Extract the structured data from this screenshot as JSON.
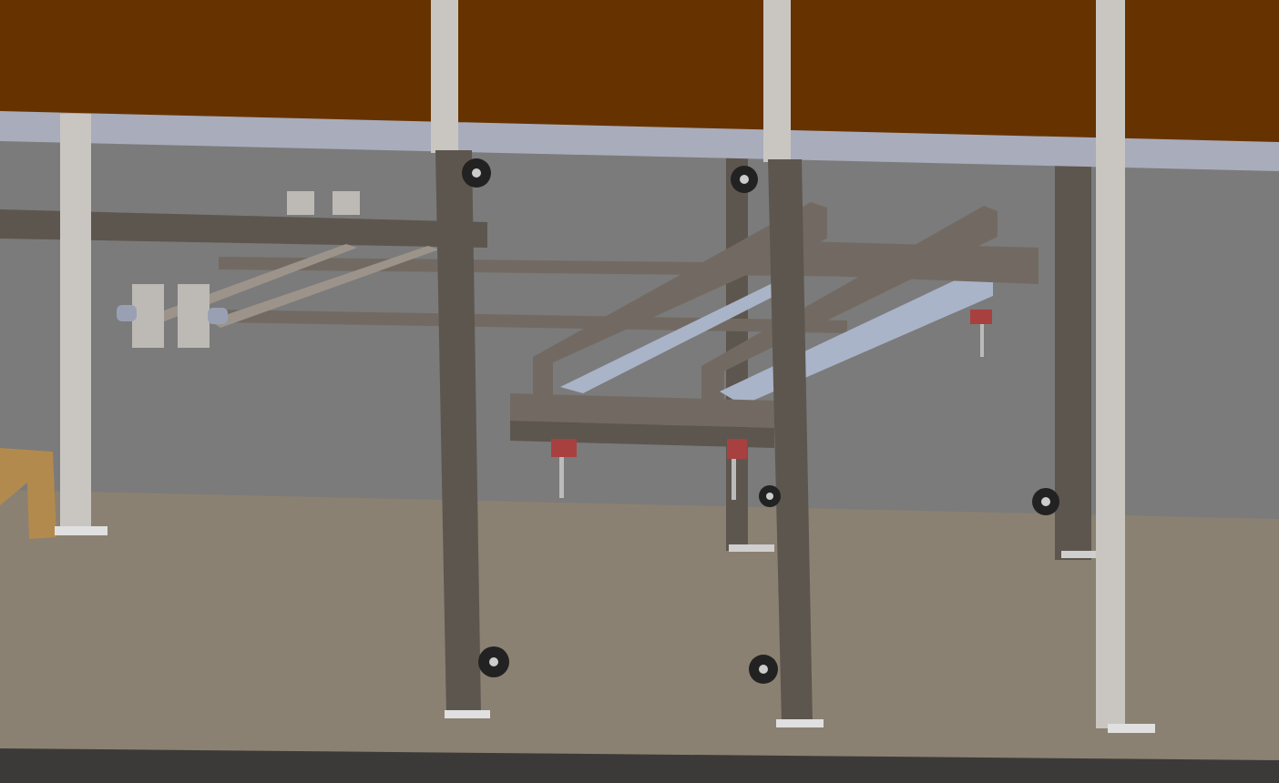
{
  "scene": {
    "colors": {
      "ceiling": "#663300",
      "wall": "#7b7b7b",
      "floor": "#8b8172",
      "floor_edge": "#3c3a38",
      "rail": "#a9acbb",
      "white_post": "#c9c6c2",
      "dark_steel": "#5d564f",
      "frame_steel": "#726a62",
      "light_frame": "#aab4c8",
      "red_bracket": "#a84040",
      "wheel": "#222222",
      "wood": "#b38a4e"
    }
  }
}
